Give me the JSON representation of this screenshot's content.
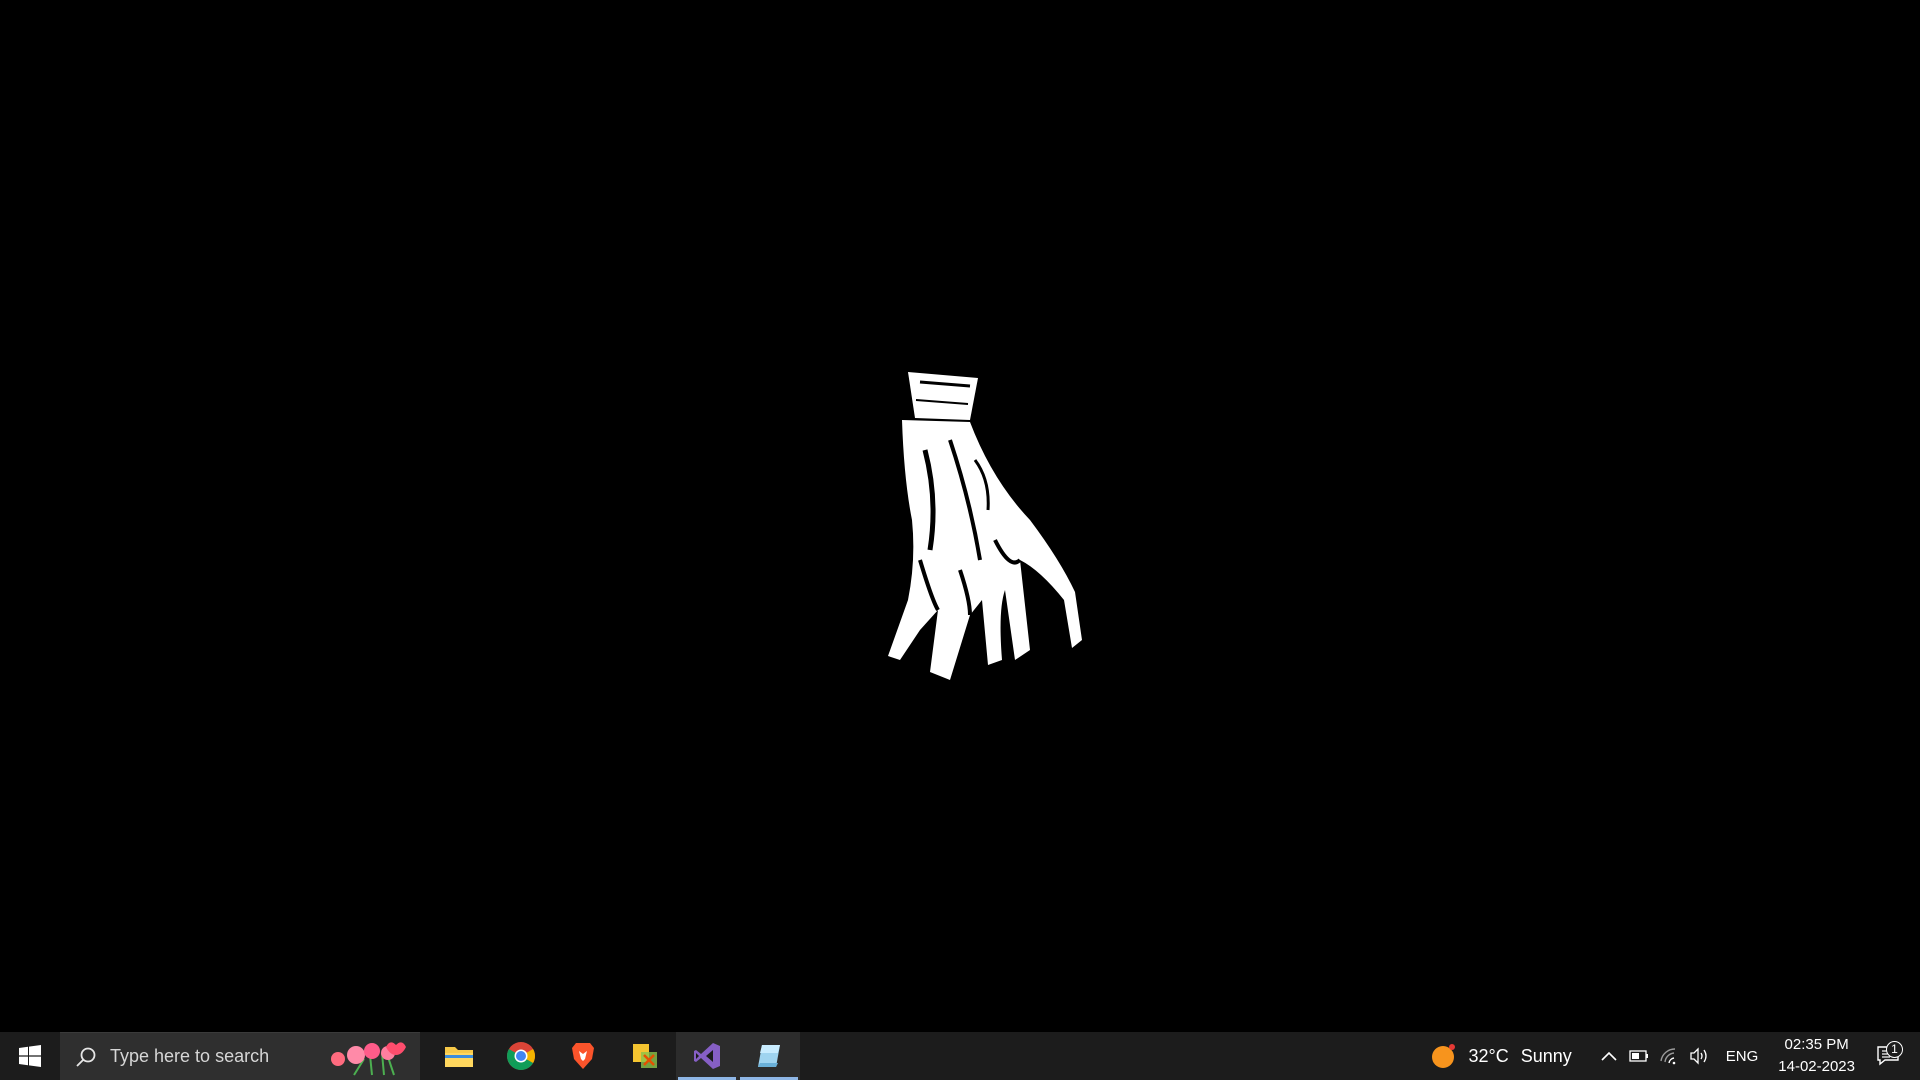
{
  "taskbar": {
    "search": {
      "placeholder": "Type here to search"
    },
    "pinned_apps": [
      {
        "name": "File Explorer",
        "icon": "folder-icon"
      },
      {
        "name": "Google Chrome",
        "icon": "chrome-icon"
      },
      {
        "name": "Brave",
        "icon": "brave-icon"
      },
      {
        "name": "Sticky tools",
        "icon": "tools-icon"
      },
      {
        "name": "Visual Studio",
        "icon": "visual-studio-icon",
        "active": true
      },
      {
        "name": "Snip",
        "icon": "snip-icon",
        "active": true
      }
    ],
    "weather": {
      "temperature": "32°C",
      "condition": "Sunny"
    },
    "language": "ENG",
    "clock": {
      "time": "02:35 PM",
      "date": "14-02-2023"
    },
    "notifications": {
      "count": "1"
    }
  },
  "colors": {
    "taskbar_bg": "#1c1c1c",
    "search_bg": "#2f2f2f",
    "active_indicator": "#8fb7e6",
    "desktop_bg": "#000000"
  }
}
